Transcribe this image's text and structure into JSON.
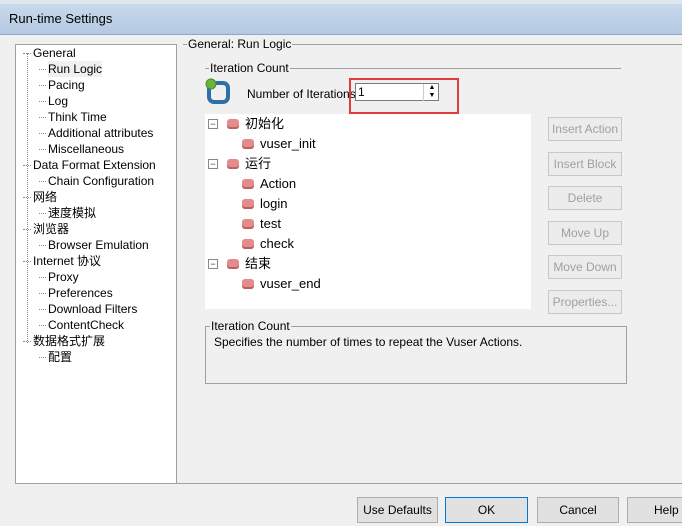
{
  "window": {
    "title": "Run-time Settings"
  },
  "sidebar": {
    "items": [
      {
        "label": "General",
        "level": 0
      },
      {
        "label": "Run Logic",
        "level": 1,
        "selected": true
      },
      {
        "label": "Pacing",
        "level": 1
      },
      {
        "label": "Log",
        "level": 1
      },
      {
        "label": "Think Time",
        "level": 1
      },
      {
        "label": "Additional attributes",
        "level": 1
      },
      {
        "label": "Miscellaneous",
        "level": 1
      },
      {
        "label": "Data Format Extension",
        "level": 0
      },
      {
        "label": "Chain Configuration",
        "level": 1
      },
      {
        "label": "网络",
        "level": 0
      },
      {
        "label": "速度模拟",
        "level": 1
      },
      {
        "label": "浏览器",
        "level": 0
      },
      {
        "label": "Browser Emulation",
        "level": 1
      },
      {
        "label": "Internet 协议",
        "level": 0
      },
      {
        "label": "Proxy",
        "level": 1
      },
      {
        "label": "Preferences",
        "level": 1
      },
      {
        "label": "Download Filters",
        "level": 1
      },
      {
        "label": "ContentCheck",
        "level": 1
      },
      {
        "label": "数据格式扩展",
        "level": 0
      },
      {
        "label": "配置",
        "level": 1
      }
    ]
  },
  "main": {
    "group_title": "General: Run Logic",
    "iteration_section": "Iteration Count",
    "iterations_label": "Number of Iterations:",
    "iterations_value": "1",
    "highlight_color": "#e23b3b",
    "tree": [
      {
        "label": "初始化",
        "level": 0
      },
      {
        "label": "vuser_init",
        "level": 1
      },
      {
        "label": "运行",
        "level": 0
      },
      {
        "label": "Action",
        "level": 1
      },
      {
        "label": "login",
        "level": 1
      },
      {
        "label": "test",
        "level": 1
      },
      {
        "label": "check",
        "level": 1
      },
      {
        "label": "结束",
        "level": 0
      },
      {
        "label": "vuser_end",
        "level": 1
      }
    ],
    "side_buttons": [
      "Insert Action",
      "Insert Block",
      "Delete",
      "Move Up",
      "Move Down",
      "Properties..."
    ],
    "description": {
      "title": "Iteration Count",
      "text": "Specifies the number of times to repeat the Vuser Actions."
    }
  },
  "footer": {
    "use_defaults": "Use Defaults",
    "ok": "OK",
    "cancel": "Cancel",
    "help": "Help"
  }
}
